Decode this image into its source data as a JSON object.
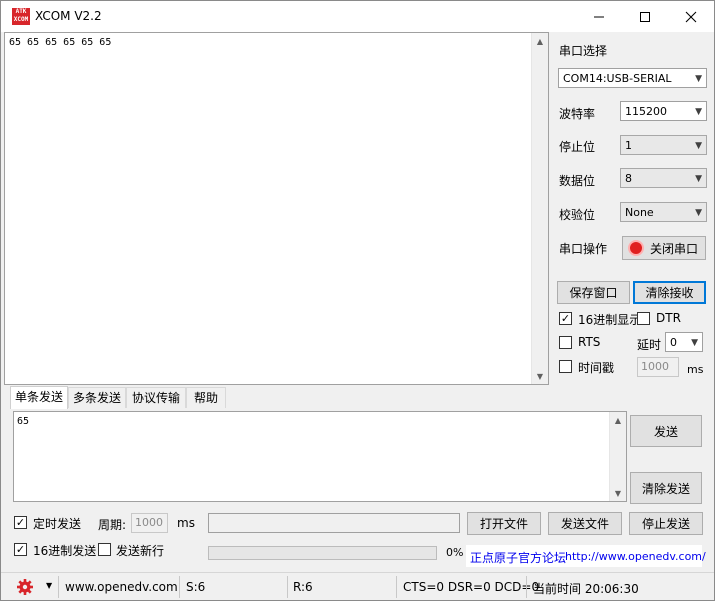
{
  "window": {
    "title": "XCOM V2.2",
    "logo_text_top": "ATK",
    "logo_text_bottom": "XCOM",
    "controls": [
      "minimize-icon",
      "maximize-icon",
      "close-icon"
    ]
  },
  "receive": {
    "text": "65 65 65 65 65 65"
  },
  "serial": {
    "port_select_label": "串口选择",
    "port_value": "COM14:USB-SERIAL",
    "baud_label": "波特率",
    "baud_value": "115200",
    "stop_label": "停止位",
    "stop_value": "1",
    "data_label": "数据位",
    "data_value": "8",
    "parity_label": "校验位",
    "parity_value": "None",
    "operation_label": "串口操作",
    "close_port_button": "关闭串口",
    "indicator_color": "#e02020"
  },
  "receive_options": {
    "save_window_button": "保存窗口",
    "clear_receive_button": "清除接收",
    "hex_display_label": "16进制显示",
    "hex_display_checked": true,
    "dtr_label": "DTR",
    "dtr_checked": false,
    "rts_label": "RTS",
    "rts_checked": false,
    "delay_label": "延时",
    "delay_value": "0",
    "timestamp_label": "时间戳",
    "timestamp_checked": false,
    "timestamp_value": "1000",
    "timestamp_unit": "ms"
  },
  "tabs": [
    {
      "label": "单条发送",
      "active": true
    },
    {
      "label": "多条发送",
      "active": false
    },
    {
      "label": "协议传输",
      "active": false
    },
    {
      "label": "帮助",
      "active": false
    }
  ],
  "send": {
    "text": "65",
    "send_button": "发送",
    "clear_send_button": "清除发送",
    "timed_send_label": "定时发送",
    "timed_send_checked": true,
    "period_label": "周期:",
    "period_value": "1000",
    "period_unit": "ms",
    "file_path": "",
    "open_file_button": "打开文件",
    "send_file_button": "发送文件",
    "stop_send_button": "停止发送",
    "hex_send_label": "16进制发送",
    "hex_send_checked": true,
    "newline_label": "发送新行",
    "newline_checked": false,
    "progress_percent": "0%",
    "progress_fraction": 0,
    "forum_text": "正点原子官方论坛",
    "forum_link": "http://www.openedv.com/"
  },
  "status": {
    "settings_icon": "gear-icon",
    "website": "www.openedv.com",
    "sent": "S:6",
    "received": "R:6",
    "lines": "CTS=0 DSR=0 DCD=0",
    "time": "当前时间 20:06:30",
    "accent_color": "#d8262b"
  }
}
